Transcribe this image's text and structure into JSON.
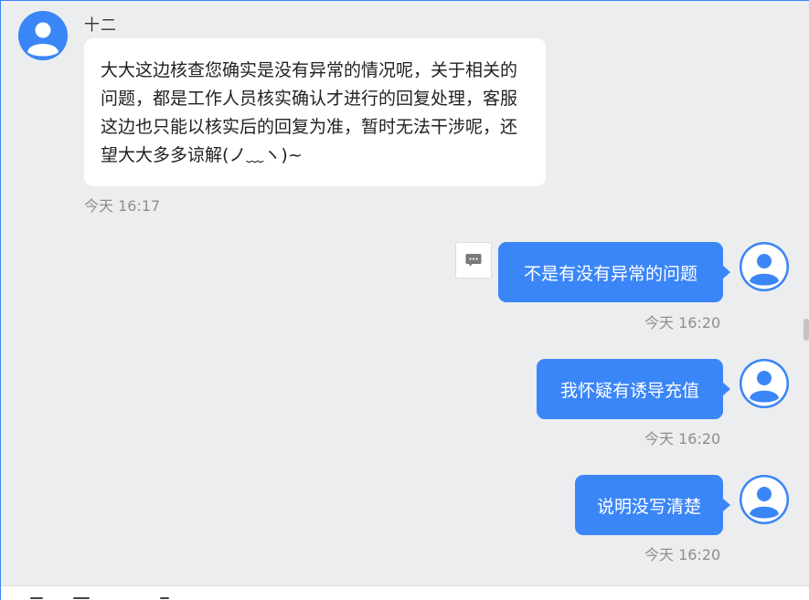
{
  "contact": {
    "name": "十二"
  },
  "messages": [
    {
      "direction": "incoming",
      "text": "大大这边核查您确实是没有异常的情况呢，关于相关的问题，都是工作人员核实确认才进行的回复处理，客服这边也只能以核实后的回复为准，暂时无法干涉呢，还望大大多多谅解(ノ﹏ヽ)~",
      "time": "今天 16:17"
    },
    {
      "direction": "outgoing",
      "text": "不是有没有异常的问题",
      "time": "今天 16:20"
    },
    {
      "direction": "outgoing",
      "text": "我怀疑有诱导充值",
      "time": "今天 16:20"
    },
    {
      "direction": "outgoing",
      "text": "说明没写清楚",
      "time": "今天 16:20"
    }
  ],
  "icons": {
    "avatar": "default-user-avatar-icon",
    "comment": "comment-bubble-icon"
  },
  "colors": {
    "accent": "#3b86f7",
    "background": "#ecedef",
    "incoming_bubble": "#ffffff",
    "timestamp": "#8e8e8e"
  }
}
